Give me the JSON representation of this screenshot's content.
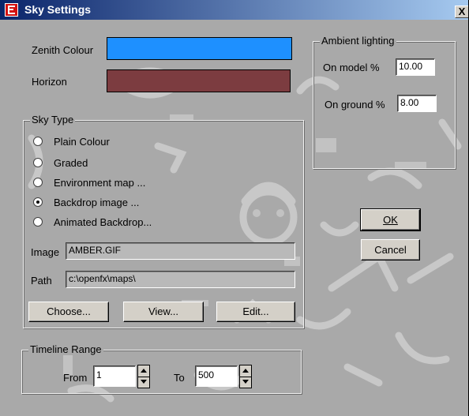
{
  "window": {
    "title": "Sky Settings",
    "close_glyph": "X"
  },
  "colours": {
    "zenith_label": "Zenith Colour",
    "zenith_color": "#1e90ff",
    "horizon_label": "Horizon",
    "horizon_color": "#7c3c40"
  },
  "ambient": {
    "legend": "Ambient lighting",
    "on_model_label": "On model %",
    "on_model_value": "10.00",
    "on_ground_label": "On ground %",
    "on_ground_value": "8.00"
  },
  "sky_type": {
    "legend": "Sky Type",
    "options": [
      {
        "label": "Plain Colour",
        "selected": false
      },
      {
        "label": "Graded",
        "selected": false
      },
      {
        "label": "Environment map ...",
        "selected": false
      },
      {
        "label": "Backdrop image ...",
        "selected": true
      },
      {
        "label": "Animated Backdrop...",
        "selected": false
      }
    ],
    "image_label": "Image",
    "image_value": "AMBER.GIF",
    "path_label": "Path",
    "path_value": "c:\\openfx\\maps\\",
    "choose_label": "Choose...",
    "view_label": "View...",
    "edit_label": "Edit..."
  },
  "timeline": {
    "legend": "Timeline Range",
    "from_label": "From",
    "from_value": "1",
    "to_label": "To",
    "to_value": "500"
  },
  "buttons": {
    "ok_label": "OK",
    "cancel_label": "Cancel"
  }
}
